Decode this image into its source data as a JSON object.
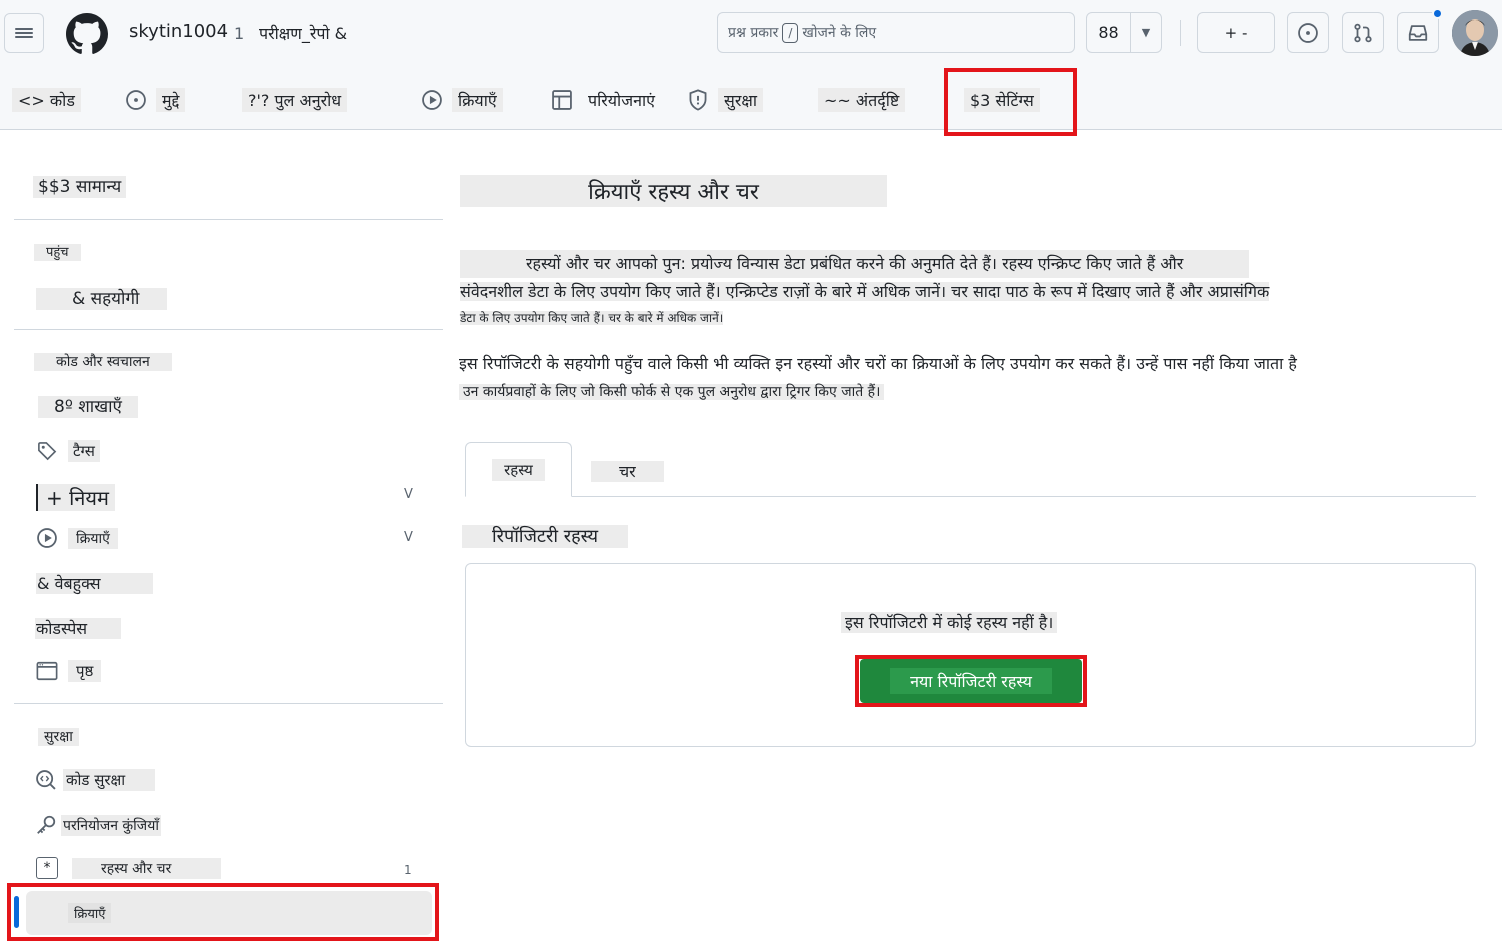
{
  "header": {
    "owner": "skytin1004",
    "separator": "1",
    "repo": "परीक्षण_रेपो &",
    "search": {
      "prefix": "प्रश्न प्रकार",
      "key": "/",
      "suffix": "खोजने के लिए"
    },
    "copilot_label": "88",
    "plus_label": "+ -"
  },
  "tabs": [
    {
      "label": "<> कोड",
      "icon": "code-icon"
    },
    {
      "label": "मुद्दे",
      "icon": "issue-icon"
    },
    {
      "label": "?'? पुल अनुरोध",
      "icon": "pull-request-icon"
    },
    {
      "label": "क्रियाएँ",
      "icon": "play-icon"
    },
    {
      "label": "परियोजनाएं",
      "icon": "table-icon"
    },
    {
      "label": "सुरक्षा",
      "icon": "shield-icon"
    },
    {
      "label": "~~ अंतर्दृष्टि",
      "icon": "graph-icon"
    },
    {
      "label": "$3 सेटिंग्स",
      "icon": "gear-icon",
      "active": true
    }
  ],
  "sidebar": {
    "general": "$$3 सामान्य",
    "access_heading": "पहुंच",
    "collaborators": "& सहयोगी",
    "code_heading": "कोड और स्वचालन",
    "branches": "8º शाखाएँ",
    "tags": "टैग्स",
    "rules": "+ नियम",
    "rules_chevron": "V",
    "actions": "क्रियाएँ",
    "actions_chevron": "V",
    "webhooks": "& वेबहुक्स",
    "codespaces": "कोडस्पेस",
    "pages": "पृष्ठ",
    "security_heading": "सुरक्षा",
    "code_security": "कोड सुरक्षा",
    "deploy_keys": "परनियोजन कुंजियाँ",
    "secrets_vars": "रहस्य और चर",
    "secrets_count": "1",
    "secrets_actions": "क्रियाएँ"
  },
  "main": {
    "title": "क्रियाएँ रहस्य और चर",
    "para1_line1": "रहस्यों और चर आपको पुन: प्रयोज्य विन्यास डेटा प्रबंधित करने की अनुमति देते हैं। रहस्य एन्क्रिप्ट किए जाते हैं और",
    "para1_line2": "संवेदनशील डेटा के लिए उपयोग किए जाते हैं। एन्क्रिप्टेड राज़ों के बारे में अधिक जानें। चर सादा पाठ के रूप में दिखाए जाते हैं और अप्रासंगिक",
    "para1_line3": "डेटा के लिए उपयोग किए जाते हैं। चर के बारे में अधिक जानें।",
    "para2_line1": "इस रिपॉजिटरी के सहयोगी पहुँच वाले किसी भी व्यक्ति इन रहस्यों और चरों का क्रियाओं के लिए उपयोग कर सकते हैं। उन्हें पास नहीं किया जाता है",
    "para2_line2": "उन कार्यप्रवाहों के लिए जो किसी फोर्क से एक पुल अनुरोध द्वारा ट्रिगर किए जाते हैं।",
    "tab_secrets": "रहस्य",
    "tab_variables": "चर",
    "section_title": "रिपॉजिटरी रहस्य",
    "empty_text": "इस रिपॉजिटरी में कोई रहस्य नहीं है।",
    "new_secret_button": "नया रिपॉजिटरी रहस्य"
  },
  "colors": {
    "accent": "#1f883d",
    "highlight": "#e3151a",
    "link": "#0969da"
  }
}
